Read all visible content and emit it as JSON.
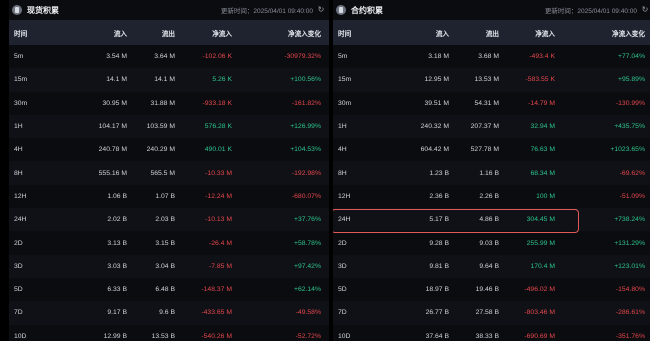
{
  "spot": {
    "title": "现货积累",
    "updated_label": "更新时间：",
    "updated_time": "2025/04/01 09:40:00",
    "columns": [
      "时间",
      "流入",
      "流出",
      "净流入",
      "净流入变化"
    ],
    "rows": [
      [
        "5m",
        "3.54 M",
        "3.64 M",
        "-102.06 K",
        "-30979.32%"
      ],
      [
        "15m",
        "14.1 M",
        "14.1 M",
        "5.26 K",
        "+100.56%"
      ],
      [
        "30m",
        "30.95 M",
        "31.88 M",
        "-933.18 K",
        "-161.82%"
      ],
      [
        "1H",
        "104.17 M",
        "103.59 M",
        "576.28 K",
        "+126.99%"
      ],
      [
        "4H",
        "240.78 M",
        "240.29 M",
        "490.01 K",
        "+104.53%"
      ],
      [
        "8H",
        "555.16 M",
        "565.5 M",
        "-10.33 M",
        "-192.98%"
      ],
      [
        "12H",
        "1.06 B",
        "1.07 B",
        "-12.24 M",
        "-680.07%"
      ],
      [
        "24H",
        "2.02 B",
        "2.03 B",
        "-10.13 M",
        "+37.76%"
      ],
      [
        "2D",
        "3.13 B",
        "3.15 B",
        "-26.4 M",
        "+58.78%"
      ],
      [
        "3D",
        "3.03 B",
        "3.04 B",
        "-7.85 M",
        "+97.42%"
      ],
      [
        "5D",
        "6.33 B",
        "6.48 B",
        "-148.37 M",
        "+62.14%"
      ],
      [
        "7D",
        "9.17 B",
        "9.6 B",
        "-433.65 M",
        "-49.58%"
      ],
      [
        "10D",
        "12.99 B",
        "13.53 B",
        "-540.26 M",
        "-52.72%"
      ]
    ]
  },
  "futures": {
    "title": "合约积累",
    "updated_label": "更新时间：",
    "updated_time": "2025/04/01 09:40:00",
    "columns": [
      "时间",
      "流入",
      "流出",
      "净流入",
      "净流入变化"
    ],
    "rows": [
      [
        "5m",
        "3.18 M",
        "3.68 M",
        "-493.4 K",
        "+77.04%"
      ],
      [
        "15m",
        "12.95 M",
        "13.53 M",
        "-583.55 K",
        "+95.89%"
      ],
      [
        "30m",
        "39.51 M",
        "54.31 M",
        "-14.79 M",
        "-130.99%"
      ],
      [
        "1H",
        "240.32 M",
        "207.37 M",
        "32.94 M",
        "+435.75%"
      ],
      [
        "4H",
        "604.42 M",
        "527.78 M",
        "76.63 M",
        "+1023.65%"
      ],
      [
        "8H",
        "1.23 B",
        "1.16 B",
        "68.34 M",
        "-69.62%"
      ],
      [
        "12H",
        "2.36 B",
        "2.26 B",
        "100 M",
        "-51.09%"
      ],
      [
        "24H",
        "5.17 B",
        "4.86 B",
        "304.45 M",
        "+738.24%"
      ],
      [
        "2D",
        "9.28 B",
        "9.03 B",
        "255.99 M",
        "+131.29%"
      ],
      [
        "3D",
        "9.81 B",
        "9.64 B",
        "170.4 M",
        "+123.01%"
      ],
      [
        "5D",
        "18.97 B",
        "19.46 B",
        "-496.02 M",
        "-154.80%"
      ],
      [
        "7D",
        "26.77 B",
        "27.58 B",
        "-803.46 M",
        "-286.61%"
      ],
      [
        "10D",
        "37.64 B",
        "38.33 B",
        "-690.69 M",
        "-351.76%"
      ]
    ],
    "highlighted_row": "24H"
  },
  "icons": {
    "logo": "coin-logo-icon",
    "refresh": "refresh-icon"
  },
  "colors": {
    "negative": "#e5484d",
    "positive": "#2ec58c",
    "highlight_border": "#e05a5a",
    "header_bg": "#1f2330"
  }
}
